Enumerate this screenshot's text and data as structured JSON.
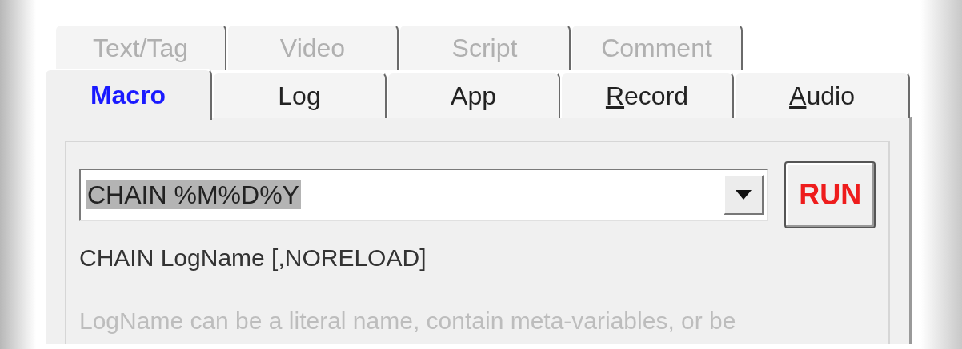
{
  "tab_rows": [
    {
      "tabs": [
        {
          "label": "Text/Tag",
          "selected": false
        },
        {
          "label": "Video",
          "selected": false
        },
        {
          "label": "Script",
          "selected": false
        },
        {
          "label": "Comment",
          "selected": false
        }
      ]
    },
    {
      "tabs": [
        {
          "label": "Macro",
          "selected": true,
          "first_letter_underlined": false
        },
        {
          "label": "Log",
          "selected": false,
          "first_letter_underlined": false
        },
        {
          "label": "App",
          "selected": false,
          "first_letter_underlined": false
        },
        {
          "label": "Record",
          "selected": false,
          "first_letter_underlined": true
        },
        {
          "label": "Audio",
          "selected": false,
          "first_letter_underlined": true
        }
      ]
    }
  ],
  "macro_combo": {
    "value": "CHAIN %M%D%Y"
  },
  "run_button": {
    "label": "RUN"
  },
  "syntax": "CHAIN LogName [,NORELOAD]",
  "description": "LogName can be a literal name, contain meta-variables, or be"
}
